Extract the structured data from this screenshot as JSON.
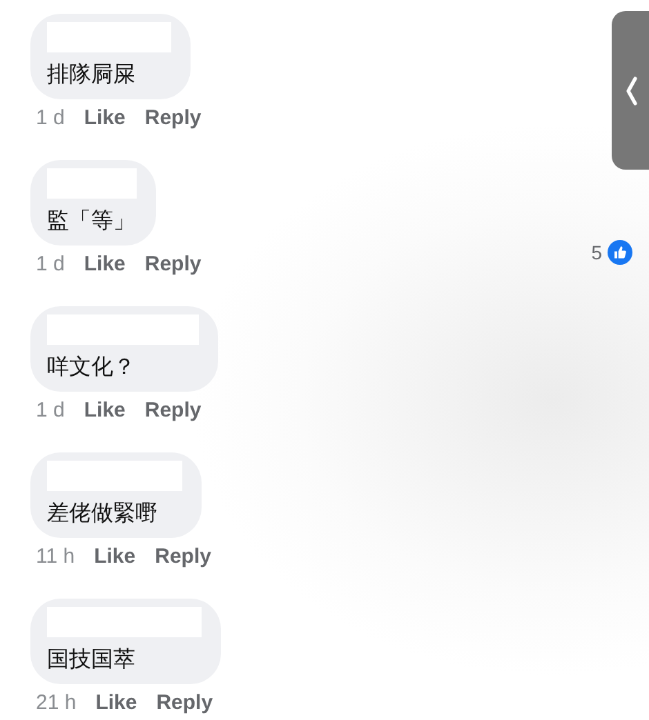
{
  "comments": [
    {
      "text": "排隊屙屎",
      "time": "1 d",
      "like": "Like",
      "reply": "Reply"
    },
    {
      "text": "監「等」",
      "time": "1 d",
      "like": "Like",
      "reply": "Reply",
      "reactions": {
        "count": "5"
      }
    },
    {
      "text": "咩文化？",
      "time": "1 d",
      "like": "Like",
      "reply": "Reply"
    },
    {
      "text": "差佬做緊嘢",
      "time": "11 h",
      "like": "Like",
      "reply": "Reply"
    },
    {
      "text": "国技国萃",
      "time": "21 h",
      "like": "Like",
      "reply": "Reply"
    }
  ]
}
